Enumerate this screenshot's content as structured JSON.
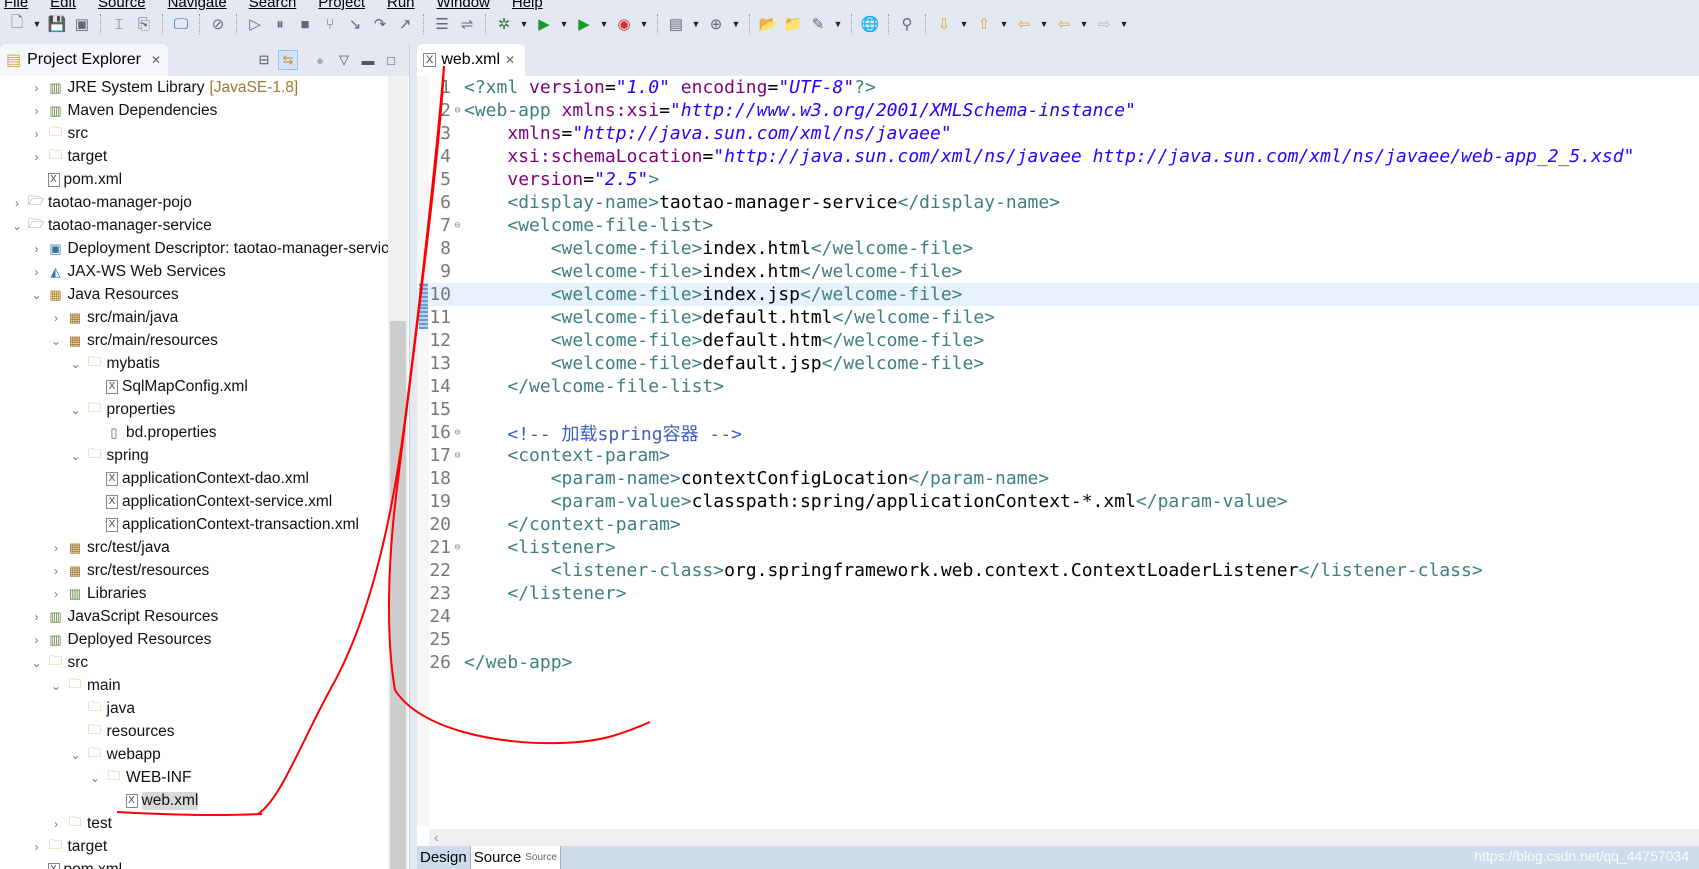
{
  "menu": [
    "File",
    "Edit",
    "Source",
    "Navigate",
    "Search",
    "Project",
    "Run",
    "Window",
    "Help"
  ],
  "toolbar": [
    "new-icon",
    "dropdown",
    "save-icon",
    "save-all-icon",
    "sep",
    "open-type-icon",
    "open-resource-icon",
    "sep",
    "console-icon",
    "sep",
    "skip-breakpoints-icon",
    "sep",
    "resume-icon",
    "suspend-icon",
    "terminate-icon",
    "disconnect-icon",
    "step-into-icon",
    "step-over-icon",
    "step-return-icon",
    "sep",
    "drop-frame-icon",
    "use-step-filters-icon",
    "sep",
    "debug-icon",
    "dropdown",
    "run-icon",
    "dropdown",
    "run-external-icon",
    "dropdown",
    "coverage-icon",
    "dropdown",
    "sep",
    "new-server-icon",
    "dropdown",
    "new-java-class-icon",
    "dropdown",
    "sep",
    "open-folder-icon",
    "open-project-icon",
    "build-icon",
    "dropdown",
    "sep",
    "web-browser-icon",
    "sep",
    "search-icon",
    "sep",
    "next-annotation-icon",
    "dropdown",
    "prev-annotation-icon",
    "dropdown",
    "last-edit-icon",
    "dropdown",
    "back-icon",
    "dropdown",
    "forward-icon",
    "dropdown"
  ],
  "explorer": {
    "title": "Project Explorer",
    "items": [
      {
        "level": 1,
        "state": "closed",
        "icon": "library",
        "label": "JRE System Library",
        "suffix": "[JavaSE-1.8]"
      },
      {
        "level": 1,
        "state": "closed",
        "icon": "library",
        "label": "Maven Dependencies"
      },
      {
        "level": 1,
        "state": "closed",
        "icon": "folder",
        "label": "src"
      },
      {
        "level": 1,
        "state": "closed",
        "icon": "folder",
        "label": "target"
      },
      {
        "level": 1,
        "state": "none",
        "icon": "xml-file",
        "label": "pom.xml"
      },
      {
        "level": 0,
        "state": "closed",
        "icon": "project",
        "label": "taotao-manager-pojo"
      },
      {
        "level": 0,
        "state": "open",
        "icon": "project",
        "label": "taotao-manager-service"
      },
      {
        "level": 1,
        "state": "closed",
        "icon": "descriptor",
        "label": "Deployment Descriptor: taotao-manager-service"
      },
      {
        "level": 1,
        "state": "closed",
        "icon": "web-services",
        "label": "JAX-WS Web Services"
      },
      {
        "level": 1,
        "state": "open",
        "icon": "java-resources",
        "label": "Java Resources"
      },
      {
        "level": 2,
        "state": "closed",
        "icon": "package-folder",
        "label": "src/main/java"
      },
      {
        "level": 2,
        "state": "open",
        "icon": "package-folder",
        "label": "src/main/resources"
      },
      {
        "level": 3,
        "state": "open",
        "icon": "folder",
        "label": "mybatis"
      },
      {
        "level": 4,
        "state": "none",
        "icon": "xml-file",
        "label": "SqlMapConfig.xml"
      },
      {
        "level": 3,
        "state": "open",
        "icon": "folder",
        "label": "properties"
      },
      {
        "level": 4,
        "state": "none",
        "icon": "file",
        "label": "bd.properties"
      },
      {
        "level": 3,
        "state": "open",
        "icon": "folder",
        "label": "spring"
      },
      {
        "level": 4,
        "state": "none",
        "icon": "xml-file",
        "label": "applicationContext-dao.xml"
      },
      {
        "level": 4,
        "state": "none",
        "icon": "xml-file",
        "label": "applicationContext-service.xml"
      },
      {
        "level": 4,
        "state": "none",
        "icon": "xml-file",
        "label": "applicationContext-transaction.xml"
      },
      {
        "level": 2,
        "state": "closed",
        "icon": "package-folder",
        "label": "src/test/java"
      },
      {
        "level": 2,
        "state": "closed",
        "icon": "package-folder",
        "label": "src/test/resources"
      },
      {
        "level": 2,
        "state": "closed",
        "icon": "library",
        "label": "Libraries"
      },
      {
        "level": 1,
        "state": "closed",
        "icon": "js-resources",
        "label": "JavaScript Resources"
      },
      {
        "level": 1,
        "state": "closed",
        "icon": "deployed",
        "label": "Deployed Resources"
      },
      {
        "level": 1,
        "state": "open",
        "icon": "folder",
        "label": "src"
      },
      {
        "level": 2,
        "state": "open",
        "icon": "folder",
        "label": "main"
      },
      {
        "level": 3,
        "state": "none",
        "icon": "folder",
        "label": "java"
      },
      {
        "level": 3,
        "state": "none",
        "icon": "folder",
        "label": "resources"
      },
      {
        "level": 3,
        "state": "open",
        "icon": "folder",
        "label": "webapp"
      },
      {
        "level": 4,
        "state": "open",
        "icon": "folder",
        "label": "WEB-INF"
      },
      {
        "level": 5,
        "state": "none",
        "icon": "xml-file",
        "label": "web.xml",
        "selected": true
      },
      {
        "level": 2,
        "state": "closed",
        "icon": "folder",
        "label": "test"
      },
      {
        "level": 1,
        "state": "closed",
        "icon": "folder",
        "label": "target"
      },
      {
        "level": 1,
        "state": "none",
        "icon": "xml-file",
        "label": "pom.xml"
      }
    ]
  },
  "editor": {
    "tab": "web.xml",
    "current_line": 10,
    "lines": [
      [
        [
          "tag",
          "<?xml "
        ],
        [
          "attr",
          "version"
        ],
        [
          "txt",
          "="
        ],
        [
          "val",
          "\"1.0\""
        ],
        [
          "txt",
          " "
        ],
        [
          "attr",
          "encoding"
        ],
        [
          "txt",
          "="
        ],
        [
          "val",
          "\"UTF-8\""
        ],
        [
          "tag",
          "?>"
        ]
      ],
      [
        [
          "tag",
          "<web-app "
        ],
        [
          "attr",
          "xmlns:xsi"
        ],
        [
          "txt",
          "="
        ],
        [
          "val",
          "\"http://www.w3.org/2001/XMLSchema-instance\""
        ]
      ],
      [
        [
          "txt",
          "    "
        ],
        [
          "attr",
          "xmlns"
        ],
        [
          "txt",
          "="
        ],
        [
          "val",
          "\"http://java.sun.com/xml/ns/javaee\""
        ]
      ],
      [
        [
          "txt",
          "    "
        ],
        [
          "attr",
          "xsi:schemaLocation"
        ],
        [
          "txt",
          "="
        ],
        [
          "val",
          "\"http://java.sun.com/xml/ns/javaee http://java.sun.com/xml/ns/javaee/web-app_2_5.xsd\""
        ]
      ],
      [
        [
          "txt",
          "    "
        ],
        [
          "attr",
          "version"
        ],
        [
          "txt",
          "="
        ],
        [
          "val",
          "\"2.5\""
        ],
        [
          "tag",
          ">"
        ]
      ],
      [
        [
          "txt",
          "    "
        ],
        [
          "tag",
          "<display-name>"
        ],
        [
          "txt",
          "taotao-manager-service"
        ],
        [
          "tag",
          "</display-name>"
        ]
      ],
      [
        [
          "txt",
          "    "
        ],
        [
          "tag",
          "<welcome-file-list>"
        ]
      ],
      [
        [
          "txt",
          "        "
        ],
        [
          "tag",
          "<welcome-file>"
        ],
        [
          "txt",
          "index.html"
        ],
        [
          "tag",
          "</welcome-file>"
        ]
      ],
      [
        [
          "txt",
          "        "
        ],
        [
          "tag",
          "<welcome-file>"
        ],
        [
          "txt",
          "index.htm"
        ],
        [
          "tag",
          "</welcome-file>"
        ]
      ],
      [
        [
          "txt",
          "        "
        ],
        [
          "tag",
          "<welcome-file>"
        ],
        [
          "txt",
          "index.jsp"
        ],
        [
          "tag",
          "</welcome-file>"
        ]
      ],
      [
        [
          "txt",
          "        "
        ],
        [
          "tag",
          "<welcome-file>"
        ],
        [
          "txt",
          "default.html"
        ],
        [
          "tag",
          "</welcome-file>"
        ]
      ],
      [
        [
          "txt",
          "        "
        ],
        [
          "tag",
          "<welcome-file>"
        ],
        [
          "txt",
          "default.htm"
        ],
        [
          "tag",
          "</welcome-file>"
        ]
      ],
      [
        [
          "txt",
          "        "
        ],
        [
          "tag",
          "<welcome-file>"
        ],
        [
          "txt",
          "default.jsp"
        ],
        [
          "tag",
          "</welcome-file>"
        ]
      ],
      [
        [
          "txt",
          "    "
        ],
        [
          "tag",
          "</welcome-file-list>"
        ]
      ],
      [],
      [
        [
          "txt",
          "    "
        ],
        [
          "com",
          "<!-- 加载spring容器 -->"
        ]
      ],
      [
        [
          "txt",
          "    "
        ],
        [
          "tag",
          "<context-param>"
        ]
      ],
      [
        [
          "txt",
          "        "
        ],
        [
          "tag",
          "<param-name>"
        ],
        [
          "txt",
          "contextConfigLocation"
        ],
        [
          "tag",
          "</param-name>"
        ]
      ],
      [
        [
          "txt",
          "        "
        ],
        [
          "tag",
          "<param-value>"
        ],
        [
          "txt",
          "classpath:spring/applicationContext-*.xml"
        ],
        [
          "tag",
          "</param-value>"
        ]
      ],
      [
        [
          "txt",
          "    "
        ],
        [
          "tag",
          "</context-param>"
        ]
      ],
      [
        [
          "txt",
          "    "
        ],
        [
          "tag",
          "<listener>"
        ]
      ],
      [
        [
          "txt",
          "        "
        ],
        [
          "tag",
          "<listener-class>"
        ],
        [
          "txt",
          "org.springframework.web.context.ContextLoaderListener"
        ],
        [
          "tag",
          "</listener-class>"
        ]
      ],
      [
        [
          "txt",
          "    "
        ],
        [
          "tag",
          "</listener>"
        ]
      ],
      [],
      [],
      [
        [
          "tag",
          "</web-app>"
        ]
      ]
    ],
    "fold_lines": [
      2,
      7,
      16,
      17,
      21
    ],
    "bottom_tabs": [
      "Design",
      "Source"
    ],
    "active_bottom_tab": "Source"
  },
  "watermark": "https://blog.csdn.net/qq_44757034",
  "colors": {
    "tag": "#3f7f7f",
    "attr": "#7f007f",
    "value": "#2a00ff",
    "comment": "#3f5fbf",
    "annotation": "#ff0000",
    "current_line": "#e8f2fe"
  }
}
